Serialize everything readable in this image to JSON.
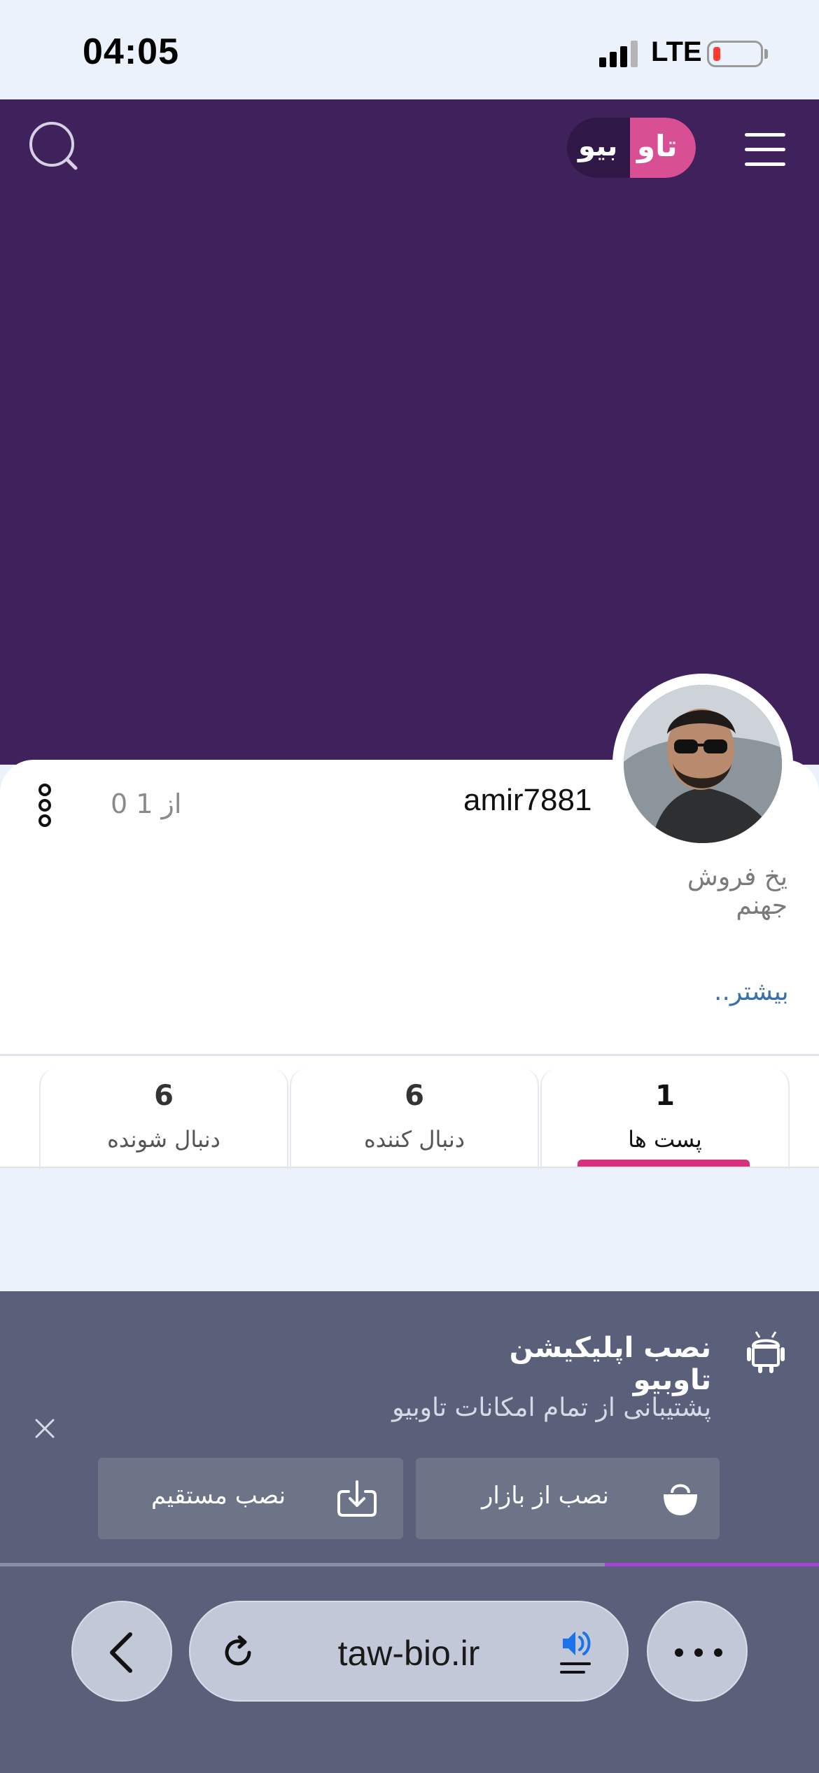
{
  "status_bar": {
    "time": "04:05",
    "network": "LTE"
  },
  "header": {
    "logo_part1": "تاو",
    "logo_part2": "بیو"
  },
  "profile": {
    "username": "amir7881",
    "pager": "0 از 1",
    "bio": "یخ فروش جهنم",
    "more_link": "بیشتر.."
  },
  "stats": [
    {
      "value": "1",
      "label": "پست ها"
    },
    {
      "value": "6",
      "label": "دنبال کننده"
    },
    {
      "value": "6",
      "label": "دنبال شونده"
    }
  ],
  "install_banner": {
    "title": "نصب اپلیکیشن تاوبیو",
    "subtitle": "پشتیبانی از تمام امکانات تاوبیو",
    "bazaar_button": "نصب از بازار",
    "direct_button": "نصب مستقیم"
  },
  "browser": {
    "url": "taw-bio.ir"
  },
  "colors": {
    "header_purple": "#3f215b",
    "logo_pink": "#d94f94",
    "active_tab_underline": "#d6307f",
    "banner_bg": "#5a6079",
    "progress": "#a543d8",
    "link_blue": "#3b70a8"
  }
}
